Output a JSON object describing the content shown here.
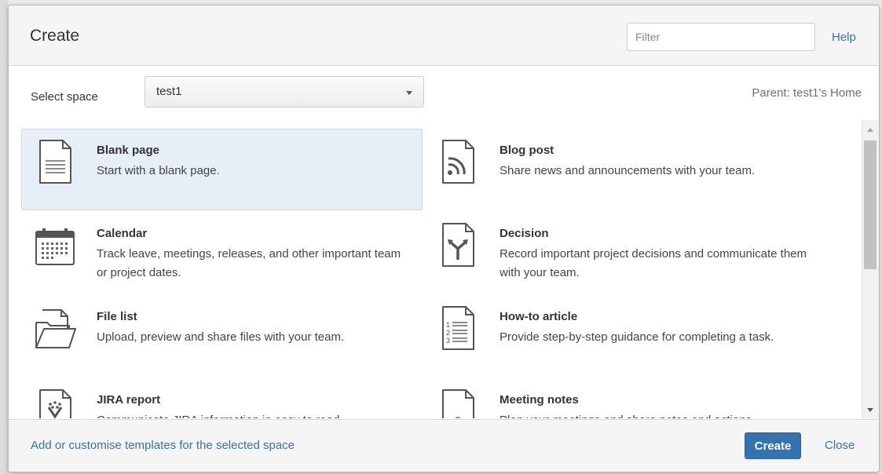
{
  "dialog": {
    "title": "Create",
    "filter_placeholder": "Filter",
    "help_label": "Help",
    "select_space_label": "Select space",
    "selected_space": "test1",
    "parent_label": "Parent: test1's Home"
  },
  "templates": [
    {
      "name": "Blank page",
      "description": "Start with a blank page.",
      "icon": "blank-page-icon",
      "selected": true
    },
    {
      "name": "Blog post",
      "description": "Share news and announcements with your team.",
      "icon": "blog-post-icon"
    },
    {
      "name": "Calendar",
      "description": "Track leave, meetings, releases, and other important team or project dates.",
      "icon": "calendar-icon"
    },
    {
      "name": "Decision",
      "description": "Record important project decisions and communicate them with your team.",
      "icon": "decision-icon"
    },
    {
      "name": "File list",
      "description": "Upload, preview and share files with your team.",
      "icon": "file-list-icon"
    },
    {
      "name": "How-to article",
      "description": "Provide step-by-step guidance for completing a task.",
      "icon": "how-to-article-icon"
    },
    {
      "name": "JIRA report",
      "description": "Communicate JIRA information in easy to read",
      "icon": "jira-report-icon"
    },
    {
      "name": "Meeting notes",
      "description": "Plan your meetings and share notes and actions",
      "icon": "meeting-notes-icon"
    }
  ],
  "footer": {
    "templates_link": "Add or customise templates for the selected space",
    "create_button": "Create",
    "close_link": "Close"
  },
  "colors": {
    "accent": "#3572b0",
    "selected_bg": "#e6eef7",
    "header_bg": "#f5f5f5"
  }
}
